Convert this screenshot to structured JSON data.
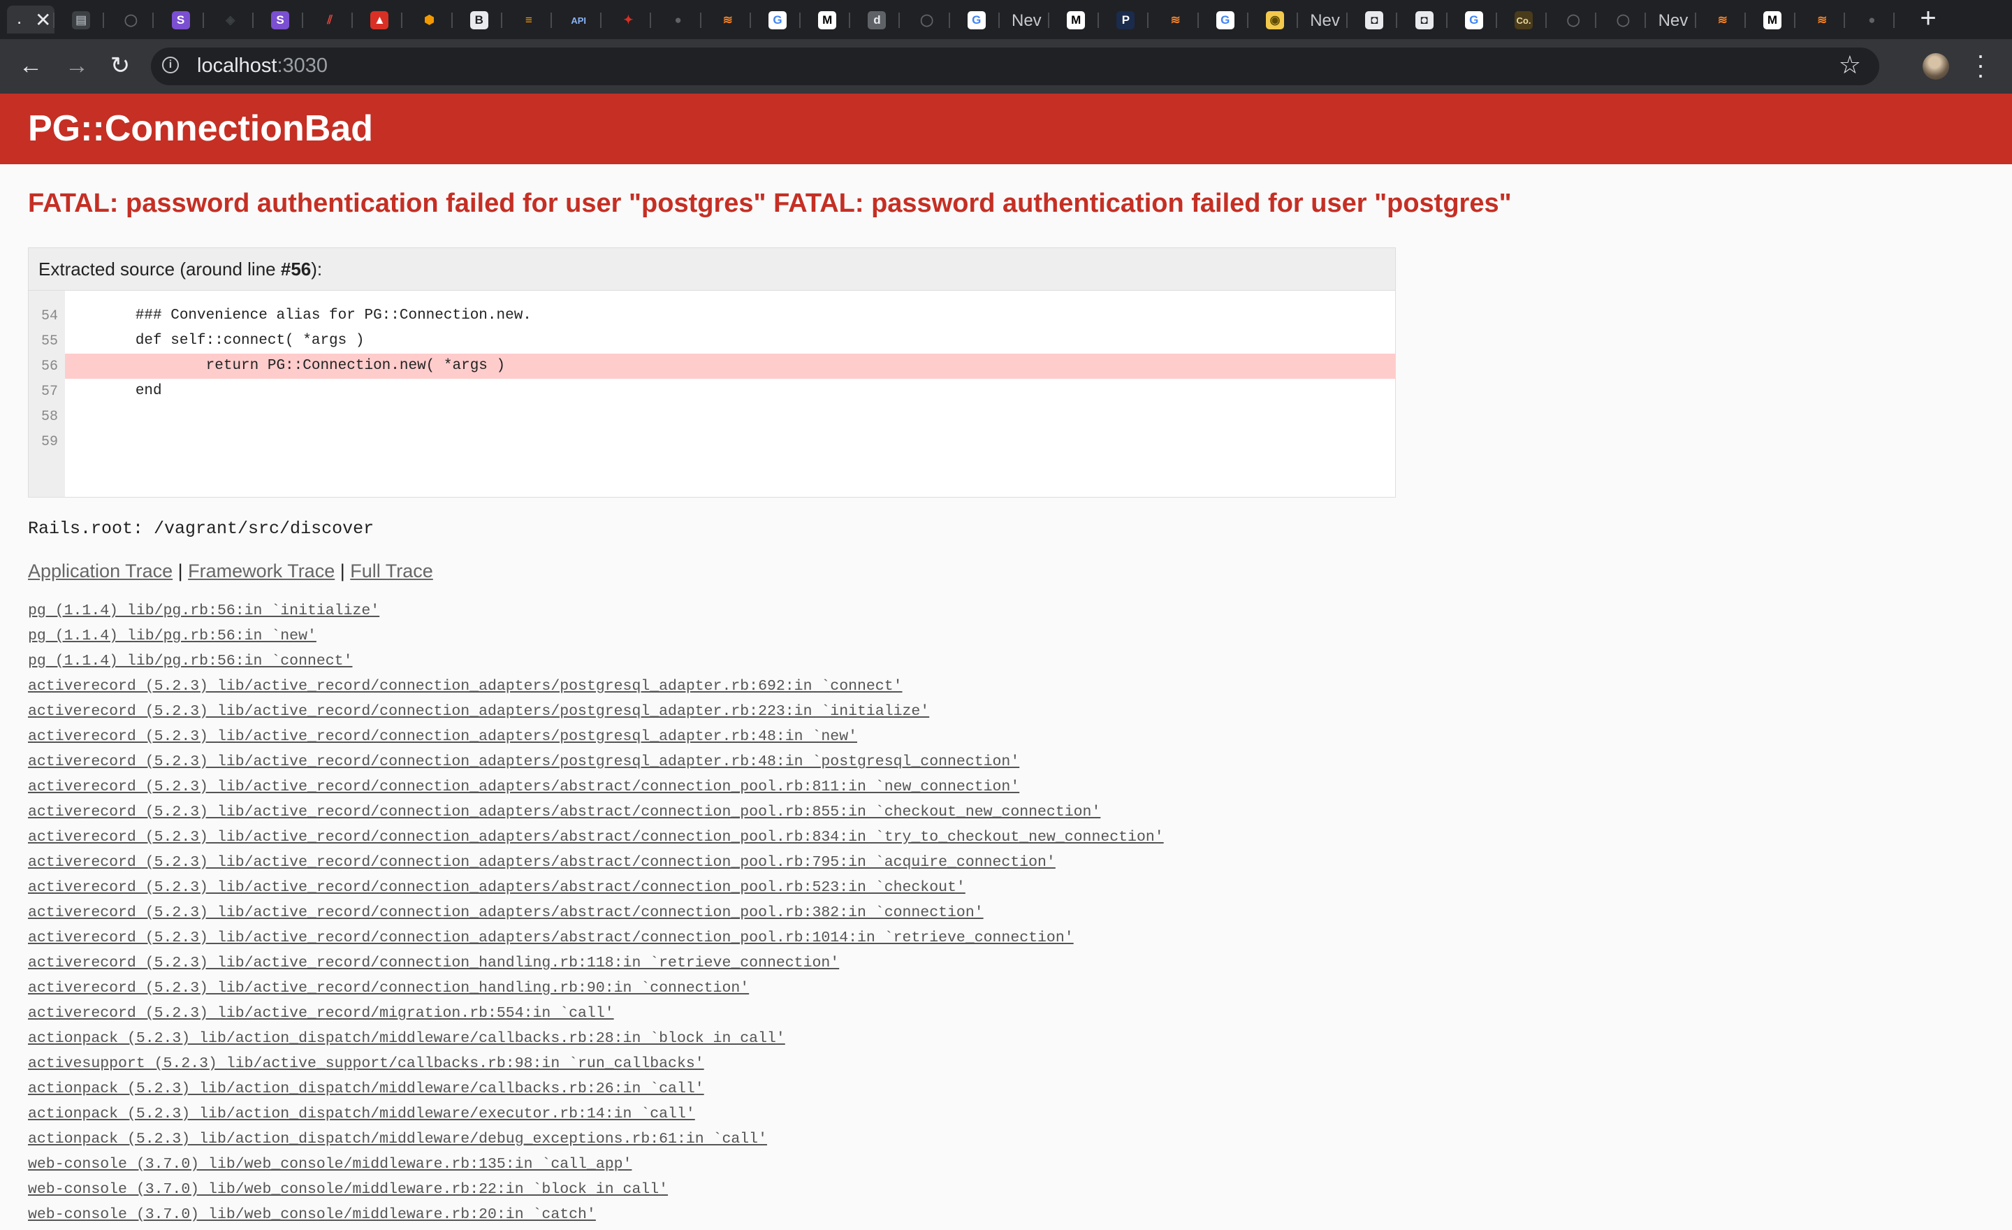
{
  "browser": {
    "tabs": [
      {
        "type": "close",
        "icon": "close-icon"
      },
      {
        "type": "fav",
        "icon": "doc-icon",
        "glyph": "▤",
        "bg": "#3c4043",
        "fg": "#9aa0a6"
      },
      {
        "type": "fav",
        "icon": "github-icon",
        "glyph": "◯",
        "bg": "#202124",
        "fg": "#5f6368"
      },
      {
        "type": "fav",
        "icon": "s-purple-icon",
        "glyph": "S",
        "bg": "#7b4fd1",
        "fg": "#ffffff"
      },
      {
        "type": "fav",
        "icon": "sketch-icon",
        "glyph": "◈",
        "bg": "#202124",
        "fg": "#3c4043"
      },
      {
        "type": "fav",
        "icon": "s-purple-icon",
        "glyph": "S",
        "bg": "#7b4fd1",
        "fg": "#ffffff"
      },
      {
        "type": "fav",
        "icon": "stripes-icon",
        "glyph": "⫽",
        "bg": "#202124",
        "fg": "#e8453c"
      },
      {
        "type": "fav",
        "icon": "red-bell-icon",
        "glyph": "▲",
        "bg": "#d93025",
        "fg": "#ffffff"
      },
      {
        "type": "fav",
        "icon": "orange-cube-icon",
        "glyph": "⬢",
        "bg": "#202124",
        "fg": "#f29900"
      },
      {
        "type": "fav",
        "icon": "bootstrap-icon",
        "glyph": "B",
        "bg": "#e8eaed",
        "fg": "#202124"
      },
      {
        "type": "fav",
        "icon": "layers-icon",
        "glyph": "≡",
        "bg": "#202124",
        "fg": "#f29900"
      },
      {
        "type": "fav",
        "icon": "api-icon",
        "glyph": "API",
        "bg": "#202124",
        "fg": "#8ab4f8"
      },
      {
        "type": "fav",
        "icon": "red-dragon-icon",
        "glyph": "✦",
        "bg": "#202124",
        "fg": "#d93025"
      },
      {
        "type": "fav",
        "icon": "globe-icon",
        "glyph": "●",
        "bg": "#202124",
        "fg": "#5f6368"
      },
      {
        "type": "fav",
        "icon": "stackoverflow-icon",
        "glyph": "≋",
        "bg": "#202124",
        "fg": "#f48024"
      },
      {
        "type": "fav",
        "icon": "google-icon",
        "glyph": "G",
        "bg": "#ffffff",
        "fg": "#4285f4"
      },
      {
        "type": "fav",
        "icon": "medium-icon",
        "glyph": "M",
        "bg": "#ffffff",
        "fg": "#000000"
      },
      {
        "type": "fav",
        "icon": "docker-icon",
        "glyph": "d",
        "bg": "#5f6368",
        "fg": "#e8eaed"
      },
      {
        "type": "fav",
        "icon": "github-icon",
        "glyph": "◯",
        "bg": "#202124",
        "fg": "#5f6368"
      },
      {
        "type": "fav",
        "icon": "google-icon",
        "glyph": "G",
        "bg": "#ffffff",
        "fg": "#4285f4"
      },
      {
        "type": "text",
        "icon": "new-tab-icon",
        "label": "Nev"
      },
      {
        "type": "fav",
        "icon": "medium-icon",
        "glyph": "M",
        "bg": "#ffffff",
        "fg": "#000000"
      },
      {
        "type": "fav",
        "icon": "p-icon",
        "glyph": "P",
        "bg": "#1a2b4c",
        "fg": "#ffffff"
      },
      {
        "type": "fav",
        "icon": "stackoverflow-icon",
        "glyph": "≋",
        "bg": "#202124",
        "fg": "#f48024"
      },
      {
        "type": "fav",
        "icon": "google-icon",
        "glyph": "G",
        "bg": "#ffffff",
        "fg": "#4285f4"
      },
      {
        "type": "fav",
        "icon": "yellow-icon",
        "glyph": "◉",
        "bg": "#f2c94c",
        "fg": "#5f4b00"
      },
      {
        "type": "text",
        "icon": "new-tab-icon",
        "label": "Nev"
      },
      {
        "type": "fav",
        "icon": "spy-icon",
        "glyph": "◘",
        "bg": "#e8eaed",
        "fg": "#202124"
      },
      {
        "type": "fav",
        "icon": "spy-icon",
        "glyph": "◘",
        "bg": "#e8eaed",
        "fg": "#202124"
      },
      {
        "type": "fav",
        "icon": "google-icon",
        "glyph": "G",
        "bg": "#ffffff",
        "fg": "#4285f4"
      },
      {
        "type": "fav",
        "icon": "co-icon",
        "glyph": "Co.",
        "bg": "#4a3b1a",
        "fg": "#e8d8a0"
      },
      {
        "type": "fav",
        "icon": "github-icon",
        "glyph": "◯",
        "bg": "#202124",
        "fg": "#5f6368"
      },
      {
        "type": "fav",
        "icon": "github-icon",
        "glyph": "◯",
        "bg": "#202124",
        "fg": "#5f6368"
      },
      {
        "type": "text",
        "icon": "new-tab-icon",
        "label": "Nev"
      },
      {
        "type": "fav",
        "icon": "stackoverflow-icon",
        "glyph": "≋",
        "bg": "#202124",
        "fg": "#f48024"
      },
      {
        "type": "fav",
        "icon": "medium-icon",
        "glyph": "M",
        "bg": "#ffffff",
        "fg": "#000000"
      },
      {
        "type": "fav",
        "icon": "stackoverflow-icon",
        "glyph": "≋",
        "bg": "#202124",
        "fg": "#f48024"
      },
      {
        "type": "fav",
        "icon": "globe-icon",
        "glyph": "●",
        "bg": "#202124",
        "fg": "#5f6368"
      }
    ],
    "url_host": "localhost",
    "url_port": ":3030"
  },
  "error": {
    "title": "PG::ConnectionBad",
    "message": "FATAL: password authentication failed for user \"postgres\" FATAL: password authentication failed for user \"postgres\"",
    "source_header_prefix": "Extracted source (around line ",
    "source_line_ref": "#56",
    "source_header_suffix": "):",
    "source_lines": [
      {
        "num": "54",
        "code": "        ### Convenience alias for PG::Connection.new.",
        "highlight": false
      },
      {
        "num": "55",
        "code": "        def self::connect( *args )",
        "highlight": false
      },
      {
        "num": "56",
        "code": "                return PG::Connection.new( *args )",
        "highlight": true
      },
      {
        "num": "57",
        "code": "        end",
        "highlight": false
      },
      {
        "num": "58",
        "code": "",
        "highlight": false
      },
      {
        "num": "59",
        "code": "",
        "highlight": false
      }
    ],
    "rails_root": "Rails.root: /vagrant/src/discover",
    "trace_links": {
      "application": "Application Trace",
      "framework": "Framework Trace",
      "full": "Full Trace",
      "separator": "|"
    },
    "trace": [
      "pg (1.1.4) lib/pg.rb:56:in `initialize'",
      "pg (1.1.4) lib/pg.rb:56:in `new'",
      "pg (1.1.4) lib/pg.rb:56:in `connect'",
      "activerecord (5.2.3) lib/active_record/connection_adapters/postgresql_adapter.rb:692:in `connect'",
      "activerecord (5.2.3) lib/active_record/connection_adapters/postgresql_adapter.rb:223:in `initialize'",
      "activerecord (5.2.3) lib/active_record/connection_adapters/postgresql_adapter.rb:48:in `new'",
      "activerecord (5.2.3) lib/active_record/connection_adapters/postgresql_adapter.rb:48:in `postgresql_connection'",
      "activerecord (5.2.3) lib/active_record/connection_adapters/abstract/connection_pool.rb:811:in `new_connection'",
      "activerecord (5.2.3) lib/active_record/connection_adapters/abstract/connection_pool.rb:855:in `checkout_new_connection'",
      "activerecord (5.2.3) lib/active_record/connection_adapters/abstract/connection_pool.rb:834:in `try_to_checkout_new_connection'",
      "activerecord (5.2.3) lib/active_record/connection_adapters/abstract/connection_pool.rb:795:in `acquire_connection'",
      "activerecord (5.2.3) lib/active_record/connection_adapters/abstract/connection_pool.rb:523:in `checkout'",
      "activerecord (5.2.3) lib/active_record/connection_adapters/abstract/connection_pool.rb:382:in `connection'",
      "activerecord (5.2.3) lib/active_record/connection_adapters/abstract/connection_pool.rb:1014:in `retrieve_connection'",
      "activerecord (5.2.3) lib/active_record/connection_handling.rb:118:in `retrieve_connection'",
      "activerecord (5.2.3) lib/active_record/connection_handling.rb:90:in `connection'",
      "activerecord (5.2.3) lib/active_record/migration.rb:554:in `call'",
      "actionpack (5.2.3) lib/action_dispatch/middleware/callbacks.rb:28:in `block in call'",
      "activesupport (5.2.3) lib/active_support/callbacks.rb:98:in `run_callbacks'",
      "actionpack (5.2.3) lib/action_dispatch/middleware/callbacks.rb:26:in `call'",
      "actionpack (5.2.3) lib/action_dispatch/middleware/executor.rb:14:in `call'",
      "actionpack (5.2.3) lib/action_dispatch/middleware/debug_exceptions.rb:61:in `call'",
      "web-console (3.7.0) lib/web_console/middleware.rb:135:in `call_app'",
      "web-console (3.7.0) lib/web_console/middleware.rb:22:in `block in call'",
      "web-console (3.7.0) lib/web_console/middleware.rb:20:in `catch'"
    ]
  },
  "colors": {
    "header_red": "#c52f24",
    "highlight_line": "#ffcccc",
    "page_bg": "#fafafa"
  }
}
